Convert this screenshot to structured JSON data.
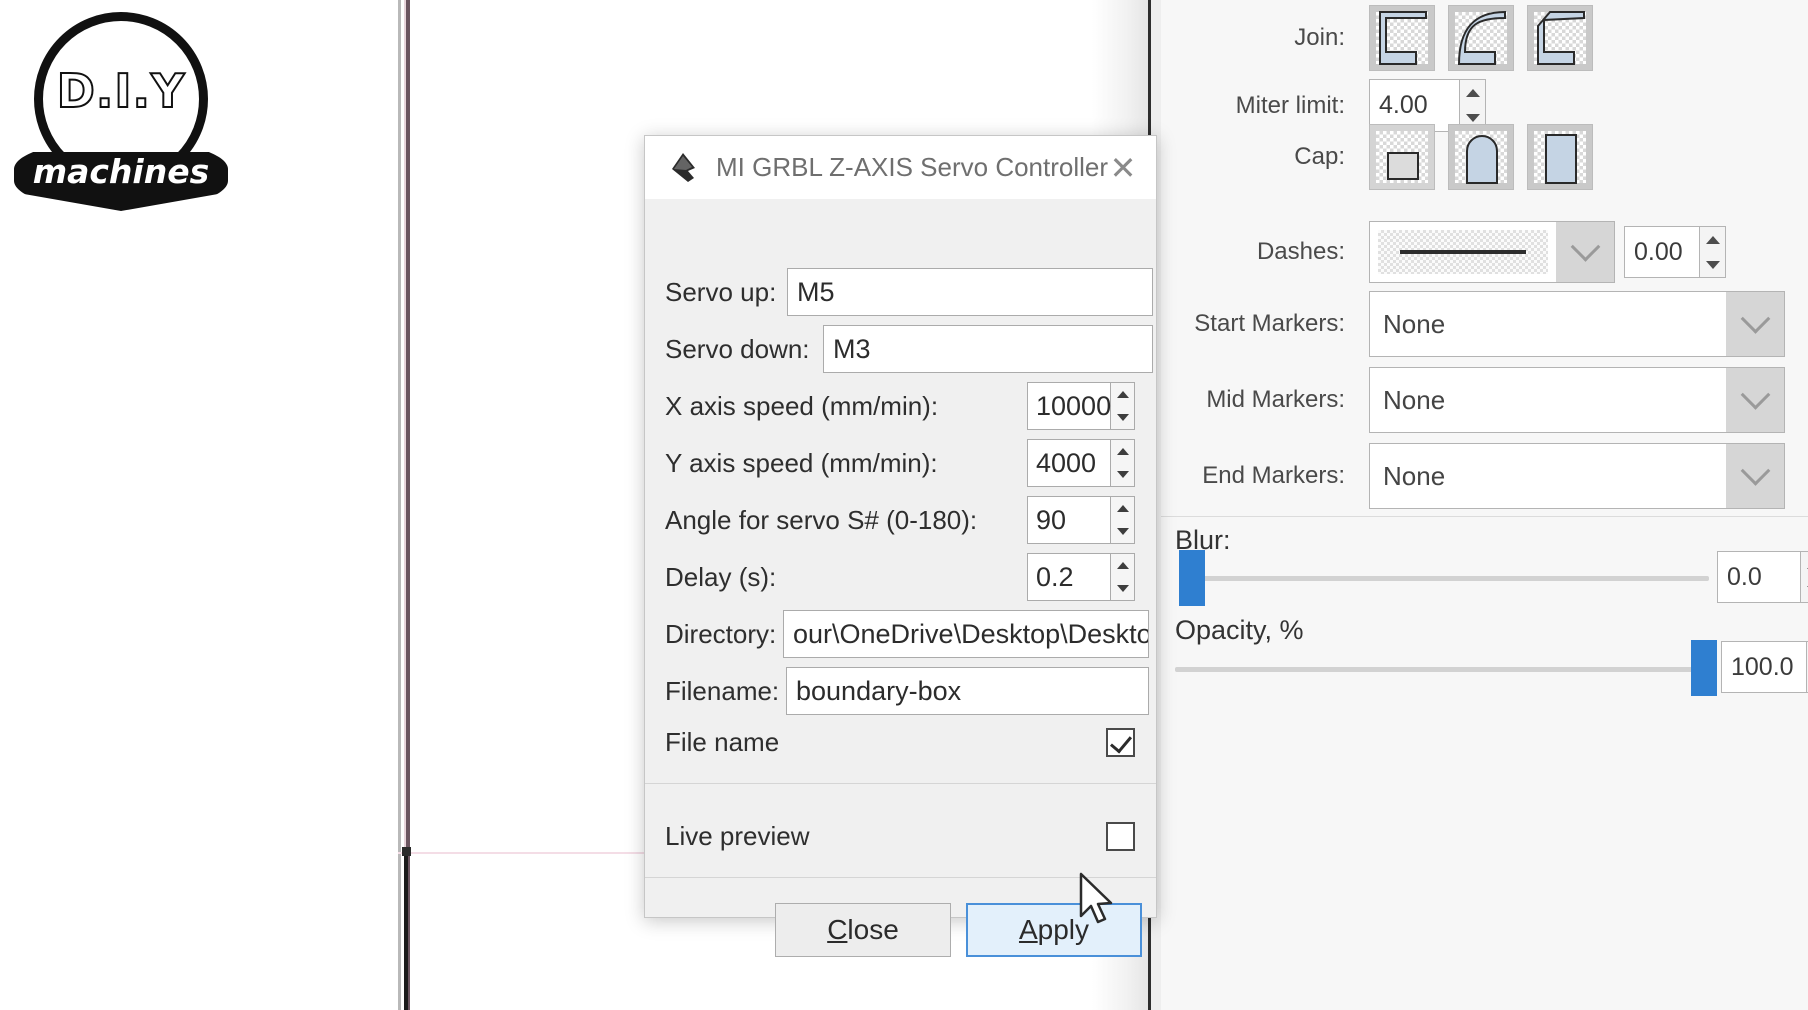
{
  "logo": {
    "top_text": "D.I.Y",
    "banner_text": "machines",
    "name": "DIY machines logo"
  },
  "dialog": {
    "title": "MI GRBL Z-AXIS Servo Controller",
    "icon": "inkscape-icon",
    "close_label": "✕",
    "fields": [
      {
        "label": "Servo up:",
        "value": "M5"
      },
      {
        "label": "Servo down:",
        "value": "M3"
      },
      {
        "label": "X axis speed (mm/min):",
        "value": "10000"
      },
      {
        "label": "Y axis speed (mm/min):",
        "value": "4000"
      },
      {
        "label": "Angle for servo S# (0-180):",
        "value": "90"
      },
      {
        "label": "Delay (s):",
        "value": "0.2"
      },
      {
        "label": "Directory:",
        "value": "our\\OneDrive\\Desktop\\Desktop"
      },
      {
        "label": "Filename:",
        "value": "boundary-box"
      }
    ],
    "checkboxes": [
      {
        "label": "File name",
        "checked": true
      },
      {
        "label": "Live preview",
        "checked": false
      }
    ],
    "buttons": {
      "close": {
        "label": "Close",
        "mnemonic": "C",
        "focused": false
      },
      "apply": {
        "label": "Apply",
        "mnemonic": "A",
        "focused": true
      }
    }
  },
  "right_panel": {
    "join": {
      "label": "Join:",
      "options": [
        "miter-join-icon",
        "round-join-icon",
        "bevel-join-icon"
      ]
    },
    "miter_limit": {
      "label": "Miter limit:",
      "value": "4.00"
    },
    "cap": {
      "label": "Cap:",
      "options": [
        "butt-cap-icon",
        "round-cap-icon",
        "square-cap-icon"
      ]
    },
    "dashes": {
      "label": "Dashes:",
      "pattern": "solid",
      "offset": "0.00"
    },
    "markers": [
      {
        "label": "Start Markers:",
        "value": "None"
      },
      {
        "label": "Mid Markers:",
        "value": "None"
      },
      {
        "label": "End Markers:",
        "value": "None"
      }
    ],
    "blur": {
      "label": "Blur:",
      "mnemonic": "l",
      "value": "0.0",
      "percent": 0
    },
    "opacity": {
      "label": "Opacity, %",
      "value": "100.0",
      "percent": 100
    },
    "accent_color": "#2f7fd0"
  }
}
